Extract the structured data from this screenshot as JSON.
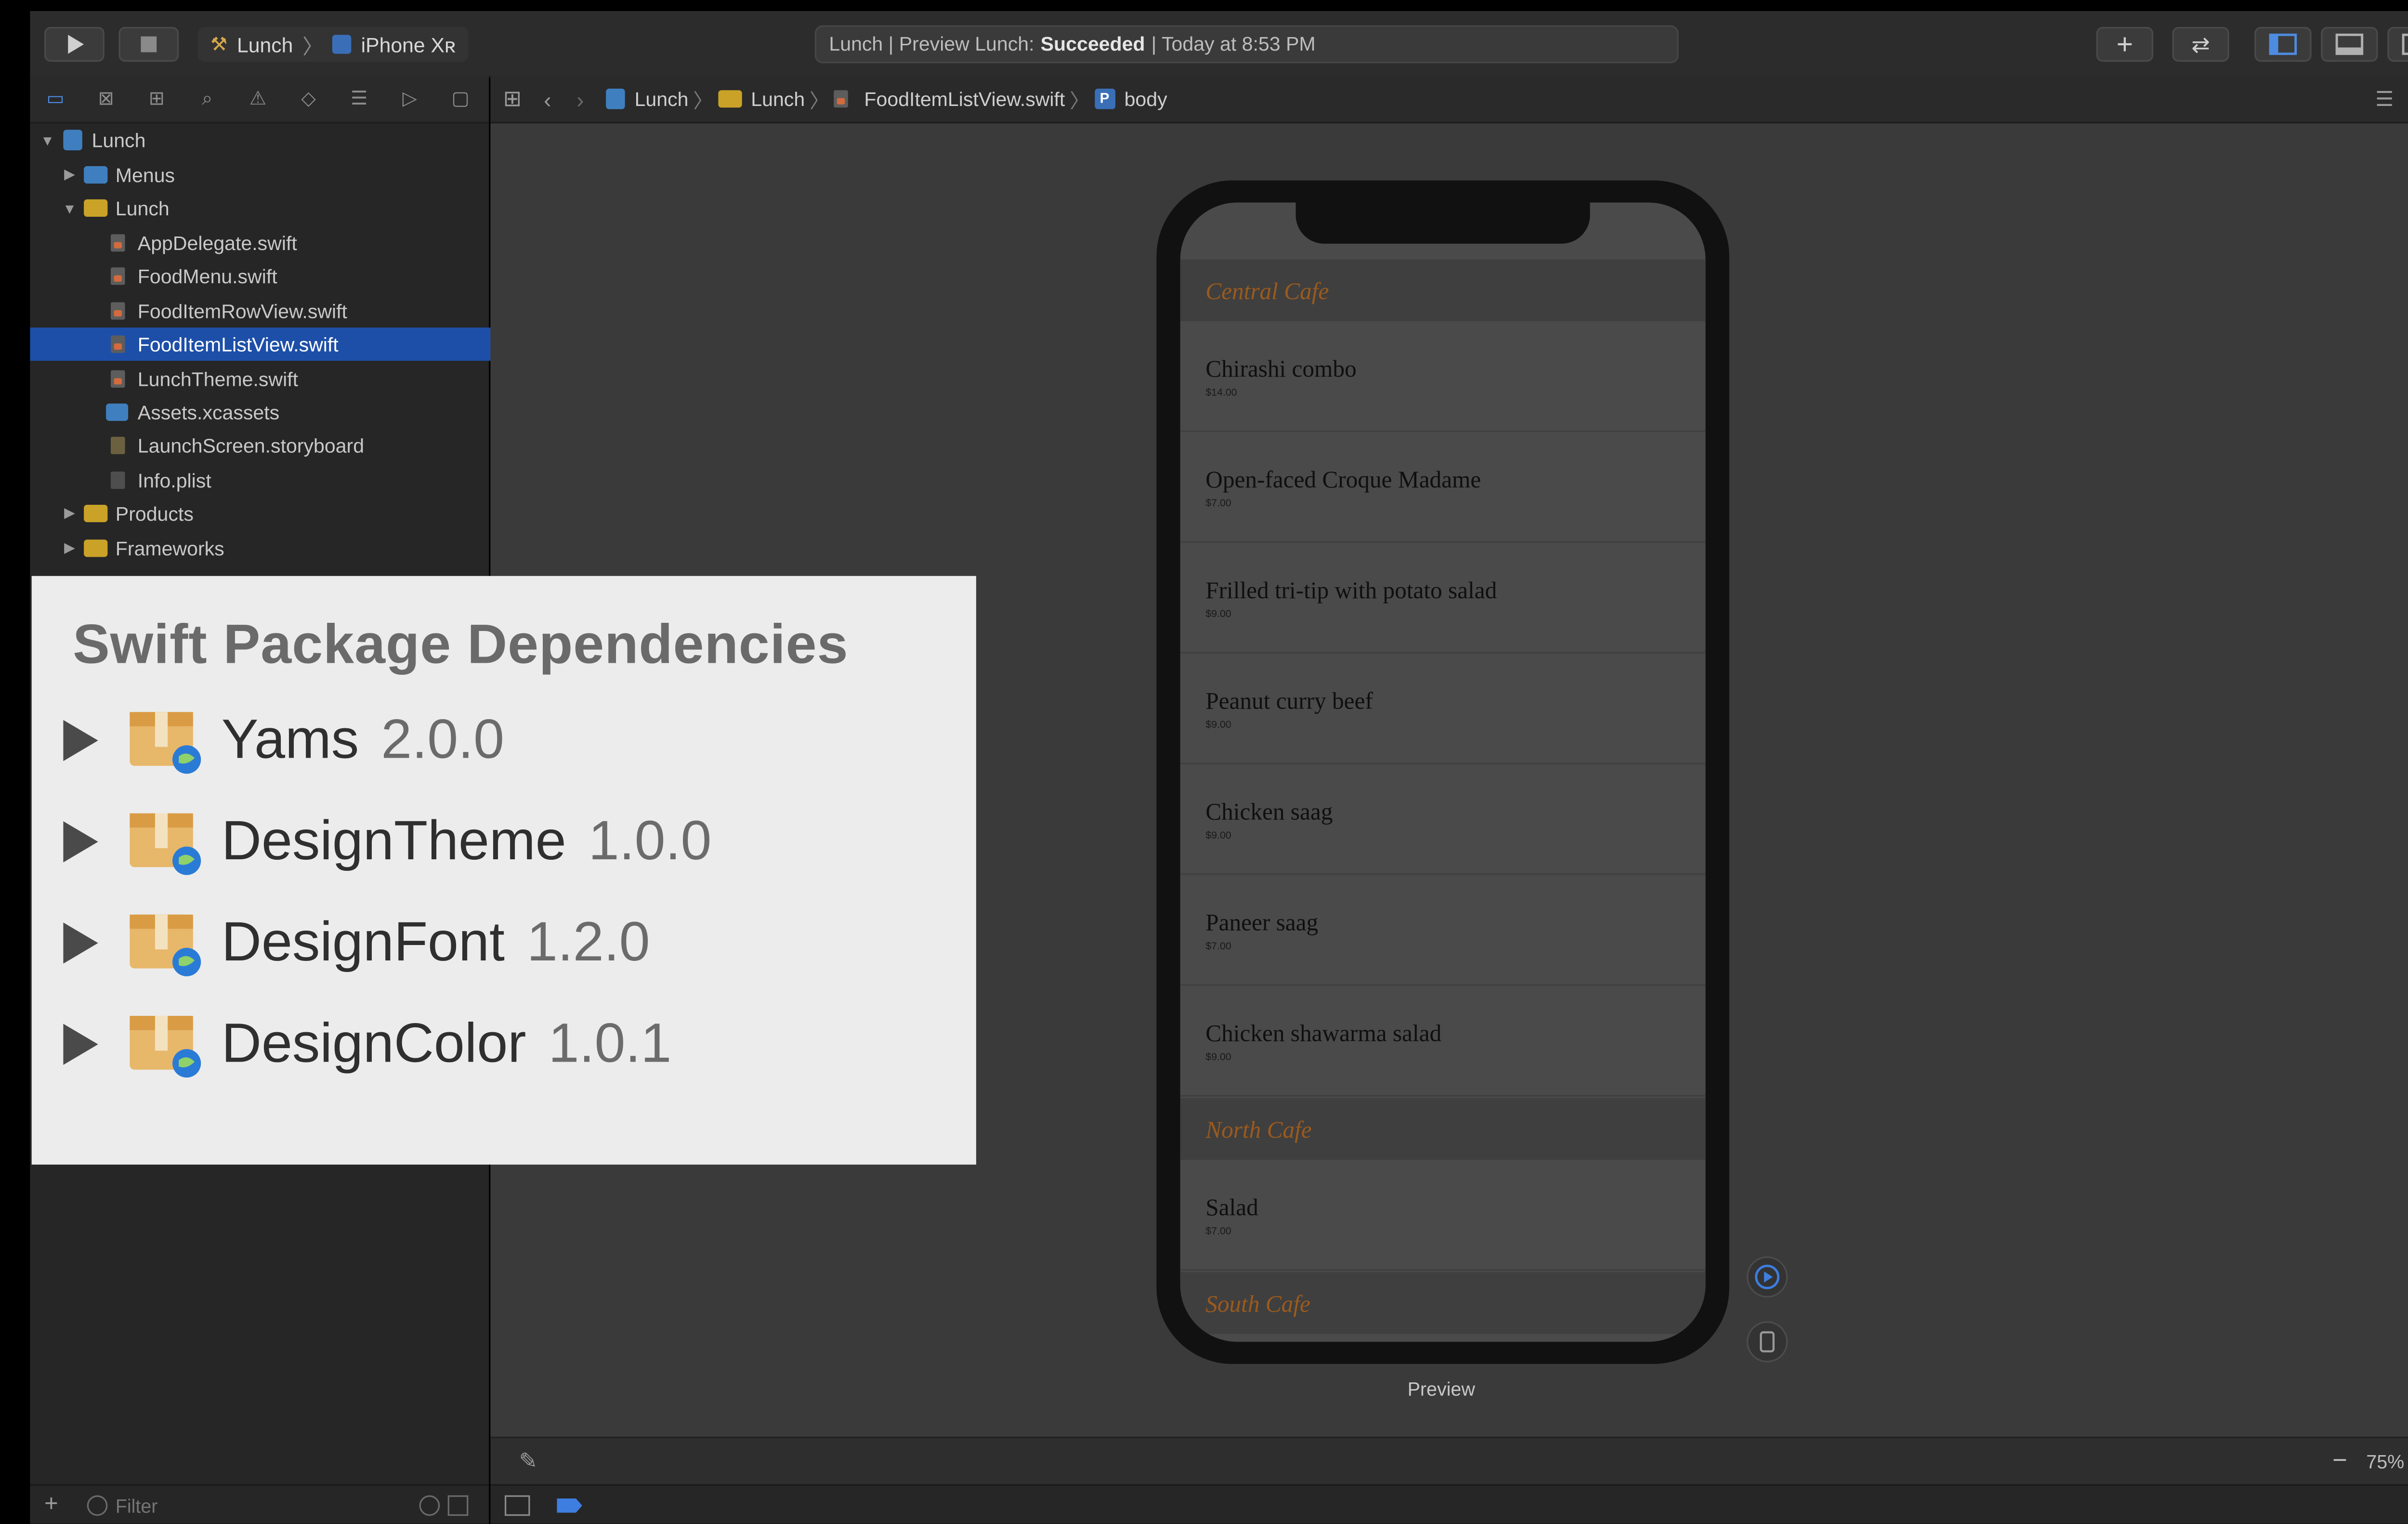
{
  "toolbar": {
    "scheme": "Lunch",
    "device": "iPhone Xʀ",
    "activity_prefix": "Lunch | Preview Lunch:",
    "activity_status": "Succeeded",
    "activity_suffix": "| Today at 8:53 PM"
  },
  "navigator": {
    "items": [
      {
        "label": "Lunch",
        "type": "project",
        "expanded": true
      },
      {
        "label": "Menus",
        "type": "folder-blue",
        "expanded": false
      },
      {
        "label": "Lunch",
        "type": "folder-yellow",
        "expanded": true
      },
      {
        "label": "AppDelegate.swift",
        "type": "swift"
      },
      {
        "label": "FoodMenu.swift",
        "type": "swift"
      },
      {
        "label": "FoodItemRowView.swift",
        "type": "swift"
      },
      {
        "label": "FoodItemListView.swift",
        "type": "swift",
        "selected": true
      },
      {
        "label": "LunchTheme.swift",
        "type": "swift"
      },
      {
        "label": "Assets.xcassets",
        "type": "assets"
      },
      {
        "label": "LaunchScreen.storyboard",
        "type": "storyboard"
      },
      {
        "label": "Info.plist",
        "type": "plist"
      },
      {
        "label": "Products",
        "type": "folder-yellow",
        "expanded": false
      },
      {
        "label": "Frameworks",
        "type": "folder-yellow",
        "expanded": false
      }
    ],
    "filter_placeholder": "Filter"
  },
  "jumpbar": {
    "crumbs": [
      "Lunch",
      "Lunch",
      "FoodItemListView.swift",
      "body"
    ]
  },
  "preview": {
    "label": "Preview",
    "sections": [
      {
        "title": "Central Cafe",
        "items": [
          {
            "name": "Chirashi combo",
            "price": "$14.00"
          },
          {
            "name": "Open-faced Croque Madame",
            "price": "$7.00"
          },
          {
            "name": "Frilled tri-tip with potato salad",
            "price": "$9.00"
          },
          {
            "name": "Peanut curry beef",
            "price": "$9.00"
          },
          {
            "name": "Chicken saag",
            "price": "$9.00"
          },
          {
            "name": "Paneer saag",
            "price": "$7.00"
          },
          {
            "name": "Chicken shawarma salad",
            "price": "$9.00"
          }
        ]
      },
      {
        "title": "North Cafe",
        "items": [
          {
            "name": "Salad",
            "price": "$7.00"
          }
        ]
      },
      {
        "title": "South Cafe",
        "items": []
      }
    ]
  },
  "zoom": "75%",
  "dependencies": {
    "title": "Swift Package Dependencies",
    "packages": [
      {
        "name": "Yams",
        "version": "2.0.0"
      },
      {
        "name": "DesignTheme",
        "version": "1.0.0"
      },
      {
        "name": "DesignFont",
        "version": "1.2.0"
      },
      {
        "name": "DesignColor",
        "version": "1.0.1"
      }
    ]
  },
  "colors": {
    "selection": "#1d4fa8",
    "section_title": "#9b5a1d",
    "folder_yellow": "#c9a227",
    "folder_blue": "#3f7fbf"
  }
}
